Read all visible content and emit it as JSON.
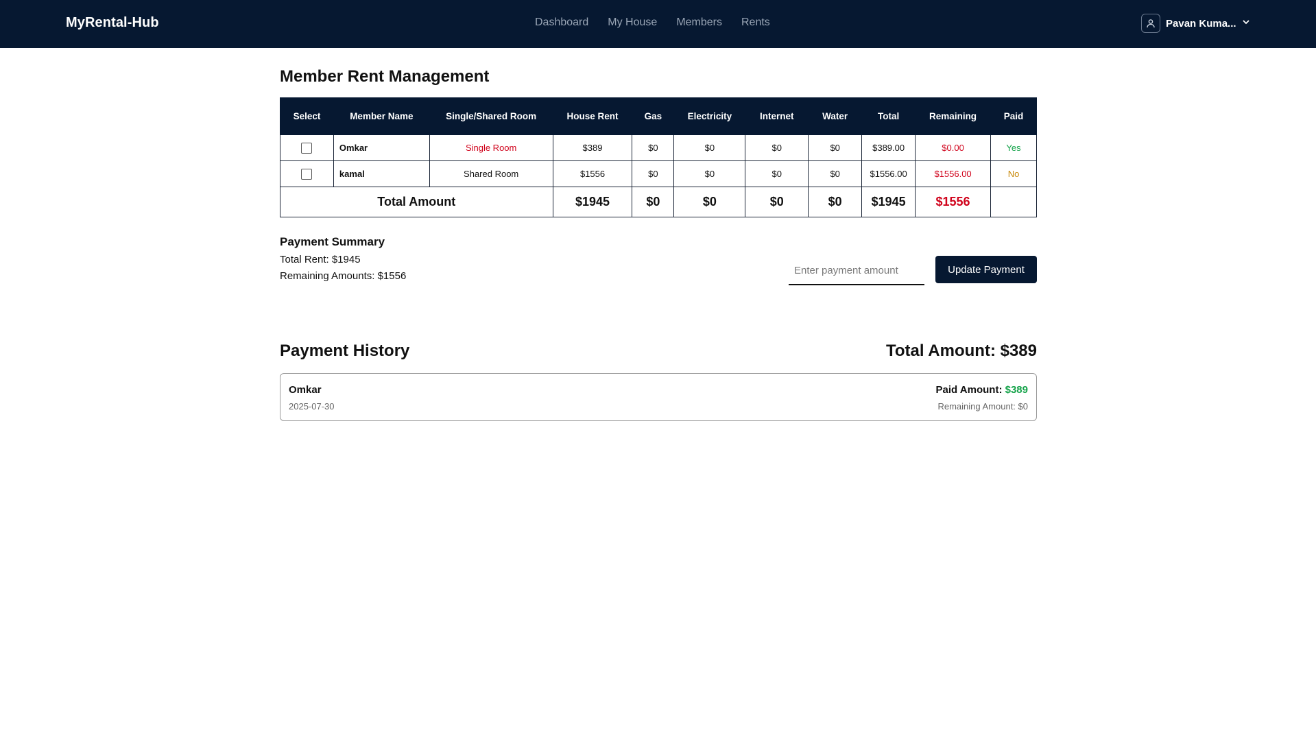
{
  "nav": {
    "brand": "MyRental-Hub",
    "links": [
      "Dashboard",
      "My House",
      "Members",
      "Rents"
    ],
    "user_name": "Pavan Kuma..."
  },
  "page": {
    "title": "Member Rent Management"
  },
  "table": {
    "headers": [
      "Select",
      "Member Name",
      "Single/Shared Room",
      "House Rent",
      "Gas",
      "Electricity",
      "Internet",
      "Water",
      "Total",
      "Remaining",
      "Paid"
    ],
    "rows": [
      {
        "name": "Omkar",
        "room": "Single Room",
        "house_rent": "$389",
        "gas": "$0",
        "electricity": "$0",
        "internet": "$0",
        "water": "$0",
        "total": "$389.00",
        "remaining": "$0.00",
        "paid": "Yes"
      },
      {
        "name": "kamal",
        "room": "Shared Room",
        "house_rent": "$1556",
        "gas": "$0",
        "electricity": "$0",
        "internet": "$0",
        "water": "$0",
        "total": "$1556.00",
        "remaining": "$1556.00",
        "paid": "No"
      }
    ],
    "totals": {
      "label": "Total Amount",
      "house_rent": "$1945",
      "gas": "$0",
      "electricity": "$0",
      "internet": "$0",
      "water": "$0",
      "total": "$1945",
      "remaining": "$1556"
    }
  },
  "summary": {
    "title": "Payment Summary",
    "total_rent": "Total Rent: $1945",
    "remaining": "Remaining Amounts: $1556",
    "input_placeholder": "Enter payment amount",
    "input_value": "",
    "button": "Update Payment"
  },
  "history": {
    "title": "Payment History",
    "total_amount": "Total Amount: $389",
    "entries": [
      {
        "name": "Omkar",
        "date": "2025-07-30",
        "paid_label": "Paid Amount: ",
        "paid_value": "$389",
        "remaining": "Remaining Amount: $0"
      }
    ]
  },
  "colors": {
    "navbar": "#061831",
    "red": "#d0021b",
    "green": "#15a34a",
    "orange": "#c98a0b"
  }
}
